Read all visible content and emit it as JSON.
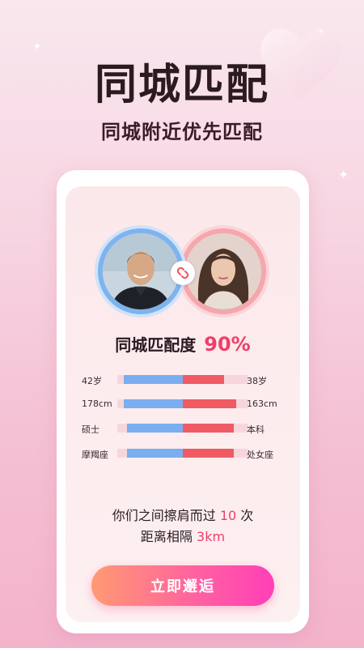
{
  "header": {
    "title": "同城匹配",
    "subtitle": "同城附近优先匹配"
  },
  "match": {
    "label": "同城匹配度",
    "value": "90%"
  },
  "comparisons": [
    {
      "left": "42岁",
      "right": "38岁",
      "blue_fraction": 0.5,
      "red_fraction": 0.35
    },
    {
      "left": "178cm",
      "right": "163cm",
      "blue_fraction": 0.5,
      "red_fraction": 0.45
    },
    {
      "left": "硕士",
      "right": "本科",
      "blue_fraction": 0.47,
      "red_fraction": 0.43
    },
    {
      "left": "摩羯座",
      "right": "处女座",
      "blue_fraction": 0.47,
      "red_fraction": 0.43
    }
  ],
  "encounter": {
    "line1_prefix": "你们之间擦肩而过",
    "times": "10",
    "line1_suffix": "次",
    "line2_prefix": "距离相隔",
    "distance": "3km"
  },
  "cta": {
    "label": "立即邂逅"
  },
  "colors": {
    "accent": "#ef3f6a",
    "male_ring": "#7fb3ee",
    "female_ring": "#f6a6ad",
    "bar_blue": "#7aaef0",
    "bar_red": "#f05a63"
  },
  "icons": {
    "link": "link-icon",
    "sparkle": "sparkle-icon",
    "heart": "heart-icon"
  }
}
